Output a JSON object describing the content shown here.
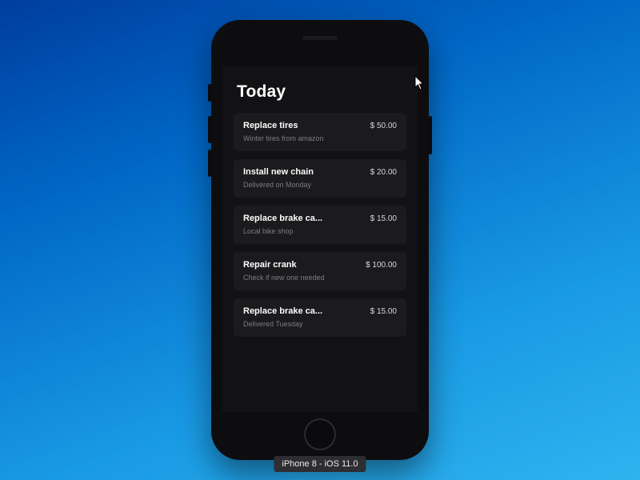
{
  "page_title": "Today",
  "items": [
    {
      "title": "Replace tires",
      "subtitle": "Winter tires from amazon",
      "price": "$ 50.00"
    },
    {
      "title": "Install new chain",
      "subtitle": "Delivered on Monday",
      "price": "$ 20.00"
    },
    {
      "title": "Replace brake ca...",
      "subtitle": "Local bike shop",
      "price": "$ 15.00"
    },
    {
      "title": "Repair crank",
      "subtitle": "Check if new one needed",
      "price": "$ 100.00"
    },
    {
      "title": "Replace brake ca...",
      "subtitle": "Delivered Tuesday",
      "price": "$ 15.00"
    }
  ],
  "device_label": "iPhone 8 - iOS 11.0"
}
